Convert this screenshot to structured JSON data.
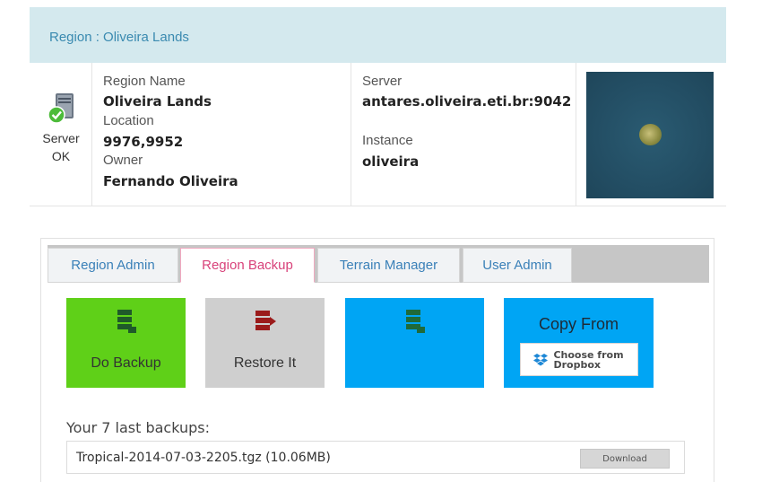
{
  "header": {
    "title": "Region : Oliveira Lands"
  },
  "status": {
    "line1": "Server",
    "line2": "OK",
    "icon": "server-ok-icon"
  },
  "region": {
    "name_label": "Region Name",
    "name": "Oliveira Lands",
    "location_label": "Location",
    "location": "9976,9952",
    "owner_label": "Owner",
    "owner": "Fernando Oliveira"
  },
  "server": {
    "server_label": "Server",
    "server": "antares.oliveira.eti.br:9042",
    "instance_label": "Instance",
    "instance": "oliveira"
  },
  "tabs": [
    {
      "label": "Region Admin",
      "active": false
    },
    {
      "label": "Region Backup",
      "active": true
    },
    {
      "label": "Terrain Manager",
      "active": false
    },
    {
      "label": "User Admin",
      "active": false
    }
  ],
  "actions": {
    "backup_label": "Do Backup",
    "restore_label": "Restore It",
    "copy_from_label": "Copy From",
    "dropbox_label": "Choose from\nDropbox"
  },
  "backups": {
    "title": "Your 7 last backups:",
    "items": [
      {
        "name": "Tropical-2014-07-03-2205.tgz (10.06MB)",
        "action": "Download"
      }
    ]
  },
  "colors": {
    "header_bg": "#d4e9ee",
    "accent_blue": "#00a5f4",
    "accent_green": "#5fd018",
    "active_tab": "#d8427a"
  }
}
